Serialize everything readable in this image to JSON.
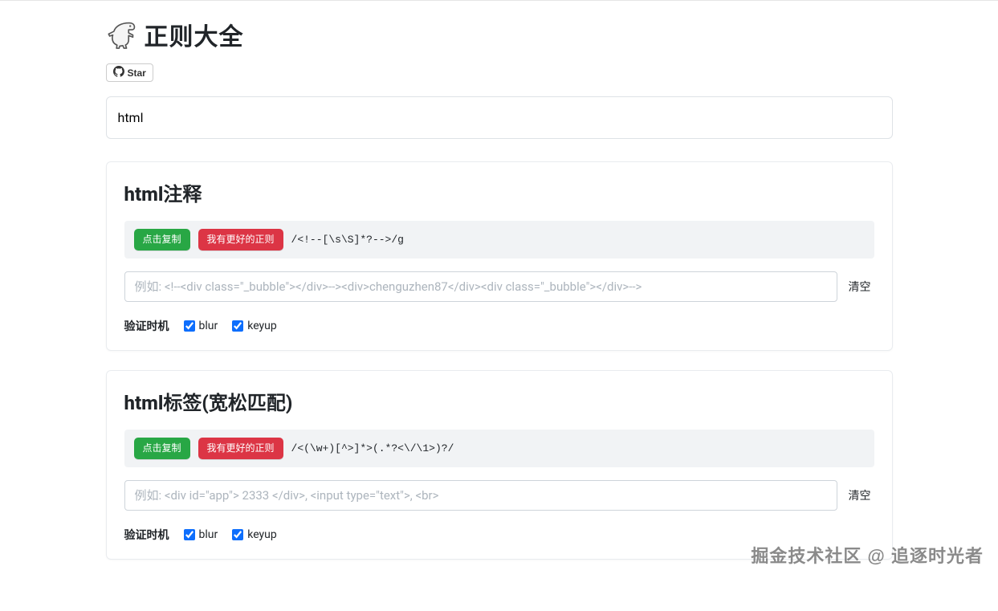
{
  "header": {
    "title": "正则大全",
    "star_label": "Star"
  },
  "search": {
    "value": "html",
    "placeholder": ""
  },
  "common": {
    "copy_label": "点击复制",
    "suggest_label": "我有更好的正则",
    "clear_label": "清空",
    "timing_label": "验证时机",
    "blur_label": "blur",
    "keyup_label": "keyup"
  },
  "cards": [
    {
      "title": "html注释",
      "regex": "/<!--[\\s\\S]*?-->/g",
      "placeholder": "例如: <!--<div class=\"_bubble\"></div>--><div>chenguzhen87</div><div class=\"_bubble\"></div>-->",
      "blur_checked": true,
      "keyup_checked": true
    },
    {
      "title": "html标签(宽松匹配)",
      "regex": "/<(\\w+)[^>]*>(.*?<\\/\\1>)?/",
      "placeholder": "例如: <div id=\"app\"> 2333 </div>, <input type=\"text\">, <br>",
      "blur_checked": true,
      "keyup_checked": true
    }
  ],
  "watermark": "掘金技术社区 @ 追逐时光者"
}
